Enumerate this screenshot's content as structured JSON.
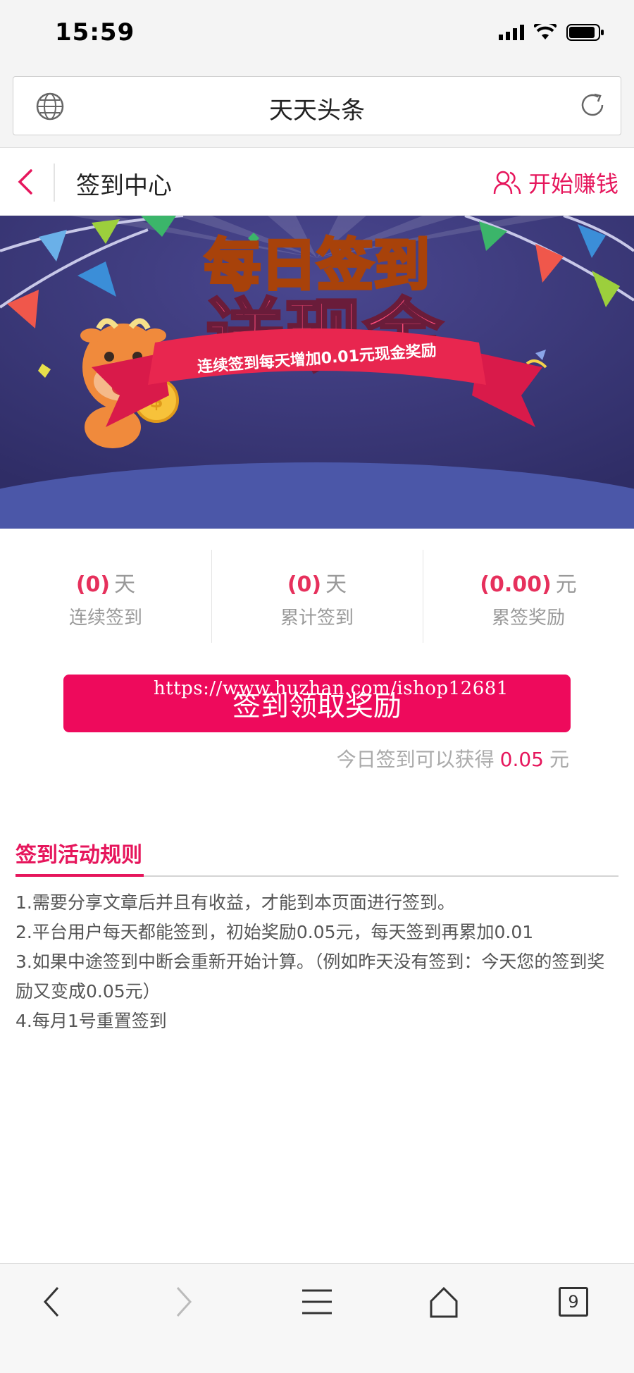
{
  "status_bar": {
    "time": "15:59"
  },
  "browser": {
    "url_title": "天天头条"
  },
  "header": {
    "title": "签到中心",
    "earn_label": "开始赚钱"
  },
  "banner": {
    "headline_top": "每日签到",
    "headline_main": "送现金",
    "ribbon": "连续签到每天增加0.01元现金奖励"
  },
  "stats": [
    {
      "value": "(0)",
      "unit": "天",
      "label": "连续签到"
    },
    {
      "value": "(0)",
      "unit": "天",
      "label": "累计签到"
    },
    {
      "value": "(0.00)",
      "unit": "元",
      "label": "累签奖励"
    }
  ],
  "sign": {
    "button_label": "签到领取奖励",
    "watermark": "https://www.huzhan.com/ishop12681",
    "reward_prefix": "今日签到可以获得",
    "reward_amount": "0.05",
    "reward_unit": "元"
  },
  "rules": {
    "title": "签到活动规则",
    "items": [
      "1.需要分享文章后并且有收益，才能到本页面进行签到。",
      "2.平台用户每天都能签到，初始奖励0.05元，每天签到再累加0.01",
      "3.如果中途签到中断会重新开始计算。（例如昨天没有签到：今天您的签到奖励又变成0.05元）",
      "4.每月1号重置签到"
    ]
  },
  "toolbar": {
    "tab_count": "9"
  },
  "colors": {
    "accent": "#ee0a5c",
    "banner_bg": "#3c3a78",
    "value_red": "#e6305c"
  }
}
